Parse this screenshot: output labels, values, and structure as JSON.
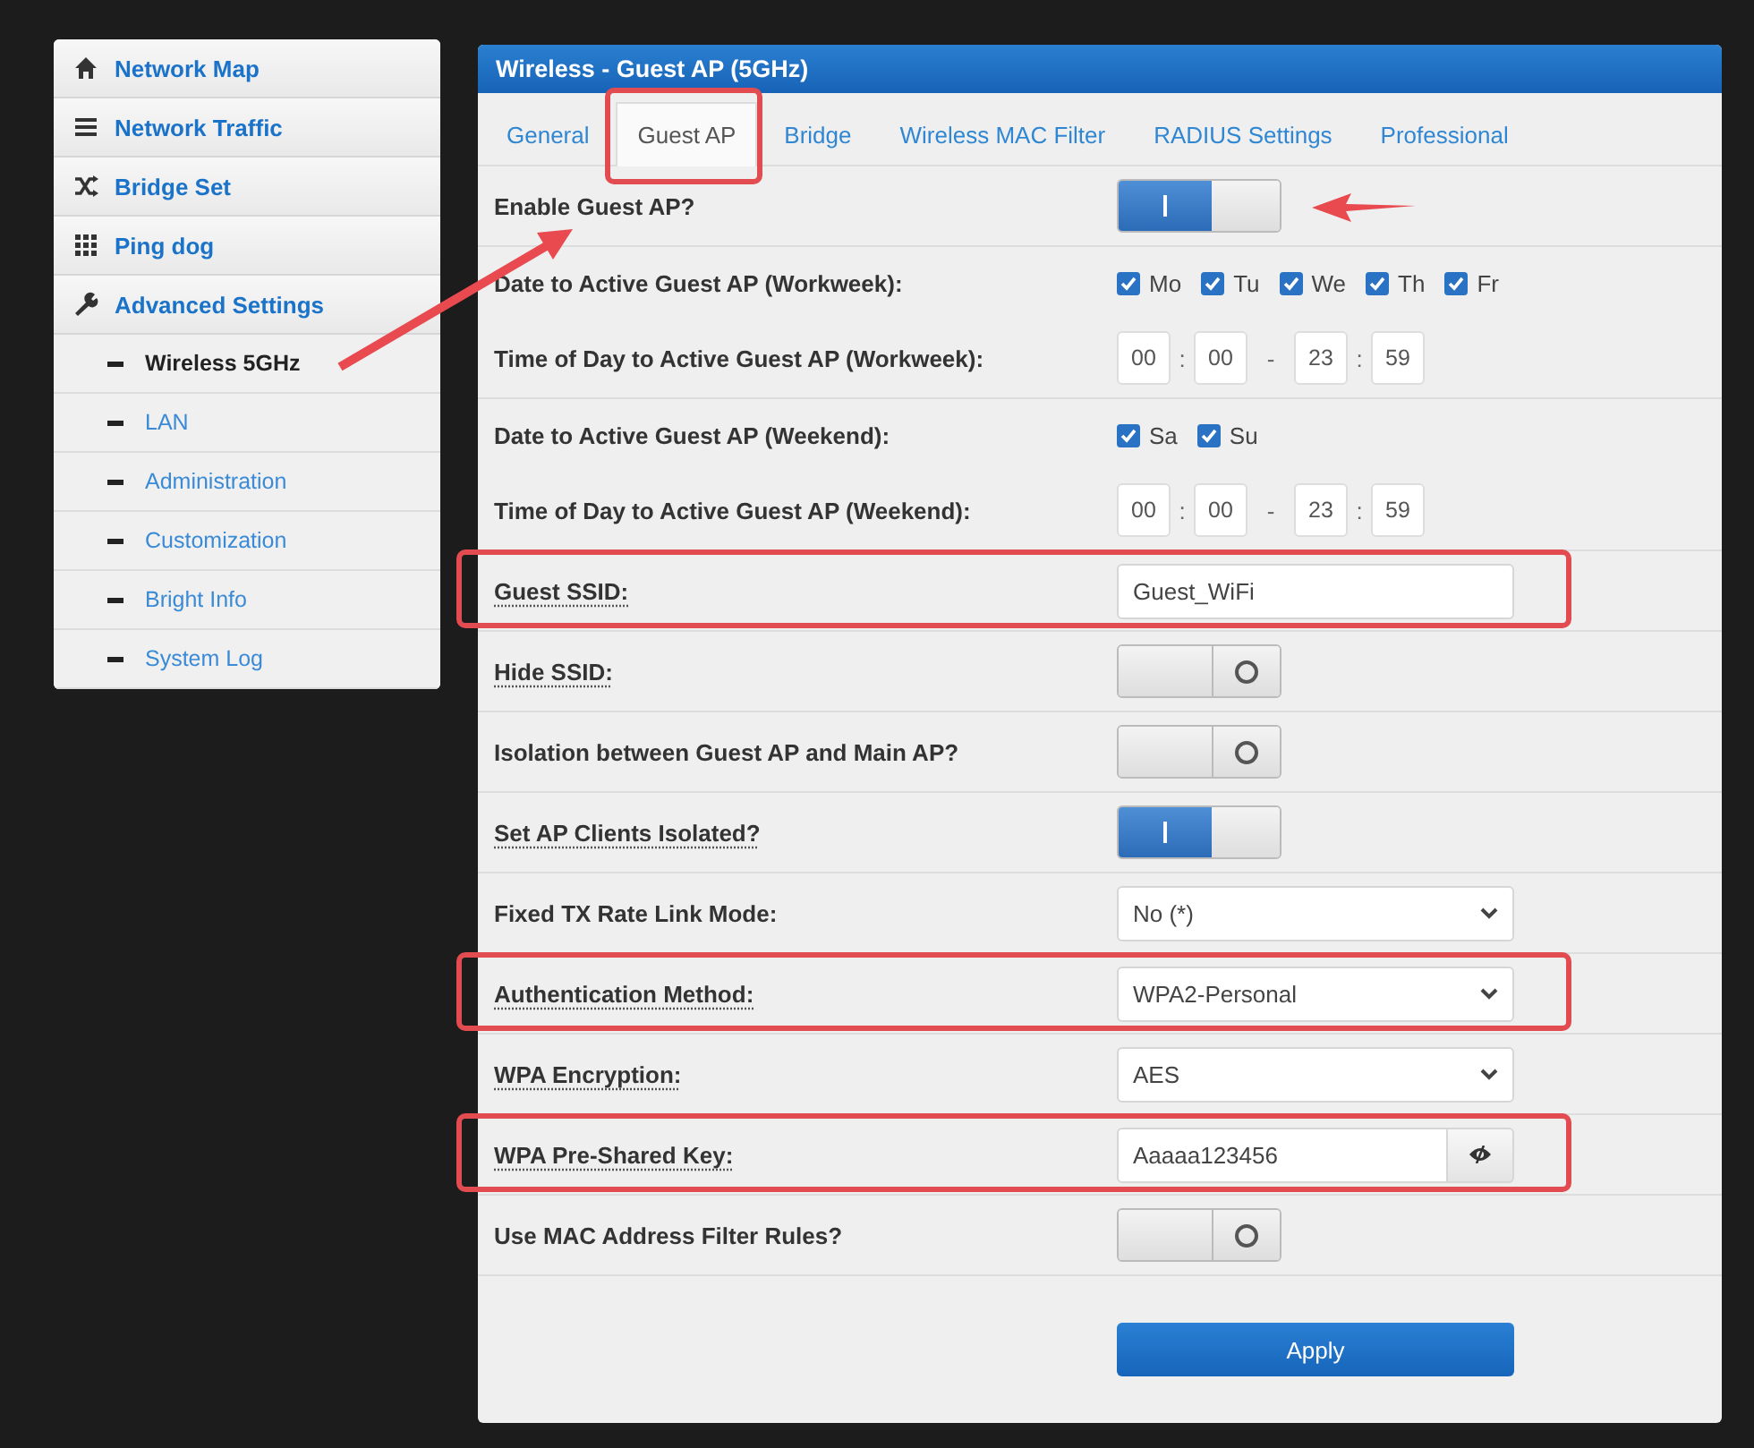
{
  "sidebar": {
    "items": [
      {
        "label": "Network Map"
      },
      {
        "label": "Network Traffic"
      },
      {
        "label": "Bridge Set"
      },
      {
        "label": "Ping dog"
      },
      {
        "label": "Advanced Settings",
        "expanded": true,
        "children": [
          {
            "label": "Wireless 5GHz",
            "selected": true,
            "arrow": true
          },
          {
            "label": "LAN",
            "selected": false,
            "arrow": false
          },
          {
            "label": "Administration",
            "selected": false,
            "arrow": false
          },
          {
            "label": "Customization",
            "selected": false,
            "arrow": false
          },
          {
            "label": "Bright Info",
            "selected": false,
            "arrow": false
          },
          {
            "label": "System Log",
            "selected": false,
            "arrow": false
          }
        ]
      }
    ]
  },
  "panel": {
    "title": "Wireless - Guest AP (5GHz)",
    "tabs": [
      {
        "label": "General",
        "selected": false,
        "highlighted": false
      },
      {
        "label": "Guest AP",
        "selected": true,
        "highlighted": true
      },
      {
        "label": "Bridge",
        "selected": false,
        "highlighted": false
      },
      {
        "label": "Wireless MAC Filter",
        "selected": false,
        "highlighted": false
      },
      {
        "label": "RADIUS Settings",
        "selected": false,
        "highlighted": false
      },
      {
        "label": "Professional",
        "selected": false,
        "highlighted": false
      }
    ],
    "rows": [
      {
        "kind": "toggle",
        "label": "Enable Guest AP?",
        "on": true,
        "arrow": true,
        "highlighted": false,
        "dotted": false,
        "joined": false
      },
      {
        "kind": "days",
        "label": "Date to Active Guest AP (Workweek):",
        "days": [
          {
            "label": "Mo",
            "checked": true
          },
          {
            "label": "Tu",
            "checked": true
          },
          {
            "label": "We",
            "checked": true
          },
          {
            "label": "Th",
            "checked": true
          },
          {
            "label": "Fr",
            "checked": true
          }
        ],
        "highlighted": false,
        "dotted": false,
        "joined": true
      },
      {
        "kind": "time",
        "label": "Time of Day to Active Guest AP (Workweek):",
        "fields": [
          "00",
          "00",
          "23",
          "59"
        ],
        "separators": [
          ":",
          "-",
          ":"
        ],
        "highlighted": false,
        "dotted": false,
        "joined": false
      },
      {
        "kind": "days",
        "label": "Date to Active Guest AP (Weekend):",
        "days": [
          {
            "label": "Sa",
            "checked": true
          },
          {
            "label": "Su",
            "checked": true
          }
        ],
        "highlighted": false,
        "dotted": false,
        "joined": true
      },
      {
        "kind": "time",
        "label": "Time of Day to Active Guest AP (Weekend):",
        "fields": [
          "00",
          "00",
          "23",
          "59"
        ],
        "separators": [
          ":",
          "-",
          ":"
        ],
        "highlighted": false,
        "dotted": false,
        "joined": false
      },
      {
        "kind": "text",
        "label": "Guest SSID:",
        "value": "Guest_WiFi",
        "highlighted": true,
        "dotted": true,
        "joined": false
      },
      {
        "kind": "toggle",
        "label": "Hide SSID:",
        "on": false,
        "highlighted": false,
        "dotted": true,
        "joined": false
      },
      {
        "kind": "toggle",
        "label": "Isolation between Guest AP and Main AP?",
        "on": false,
        "highlighted": false,
        "dotted": false,
        "joined": false
      },
      {
        "kind": "toggle",
        "label": "Set AP Clients Isolated?",
        "on": true,
        "highlighted": false,
        "dotted": true,
        "joined": false
      },
      {
        "kind": "select",
        "label": "Fixed TX Rate Link Mode:",
        "value": "No (*)",
        "highlighted": false,
        "dotted": false,
        "joined": false
      },
      {
        "kind": "select",
        "label": "Authentication Method:",
        "value": "WPA2-Personal",
        "highlighted": true,
        "dotted": true,
        "joined": false
      },
      {
        "kind": "select",
        "label": "WPA Encryption:",
        "value": "AES",
        "highlighted": false,
        "dotted": true,
        "joined": false
      },
      {
        "kind": "password",
        "label": "WPA Pre-Shared Key:",
        "value": "Aaaaa123456",
        "highlighted": true,
        "dotted": true,
        "joined": false
      },
      {
        "kind": "toggle",
        "label": "Use MAC Address Filter Rules?",
        "on": false,
        "highlighted": false,
        "dotted": false,
        "joined": false
      }
    ],
    "apply_button": "Apply"
  }
}
